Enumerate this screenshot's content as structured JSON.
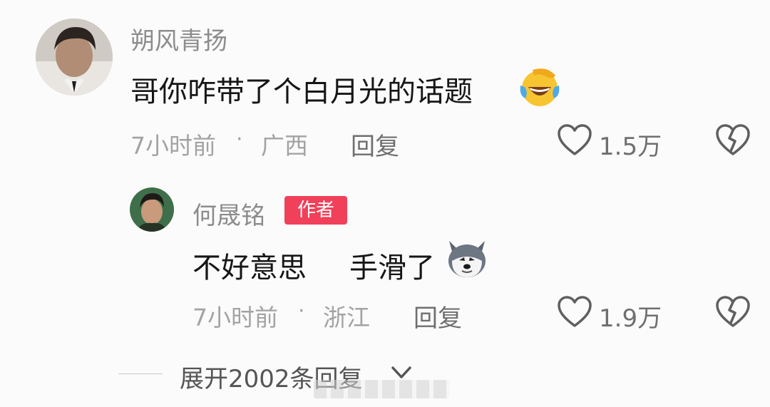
{
  "comment": {
    "username": "朔风青扬",
    "text": "哥你咋带了个白月光的话题",
    "emoji": "laughing-crying-emoji",
    "time": "7小时前",
    "separator": "·",
    "location": "广西",
    "reply_label": "回复",
    "likes": "1.5万"
  },
  "reply": {
    "username": "何晟铭",
    "badge": "作者",
    "text_part1": "不好意思",
    "text_part2": "手滑了",
    "emoji": "husky-dog-emoji",
    "time": "7小时前",
    "separator": "·",
    "location": "浙江",
    "reply_label": "回复",
    "likes": "1.9万"
  },
  "expand": {
    "label": "展开2002条回复",
    "icon": "chevron-down-icon"
  },
  "colors": {
    "badge": "#f0405a",
    "meta": "#a3a3a3",
    "name": "#8c8c8c",
    "text": "#161616"
  }
}
